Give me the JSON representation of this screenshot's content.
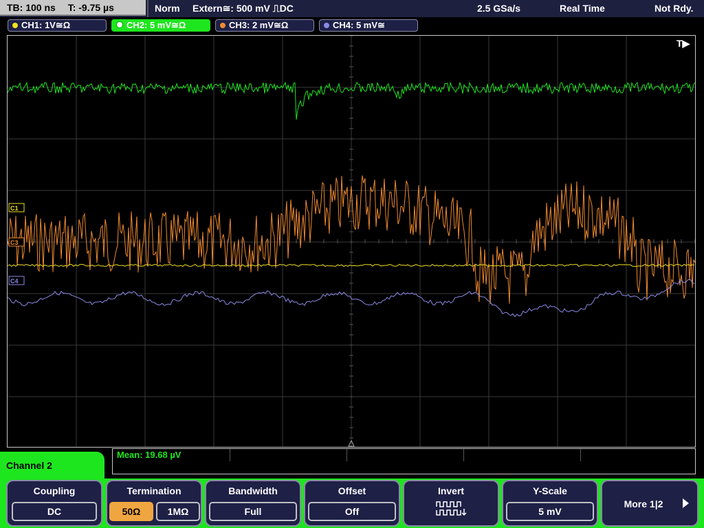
{
  "status_bar": {
    "timebase": "TB: 100 ns",
    "trigger_time": "T: -9.75 µs",
    "trigger_mode": "Norm",
    "trigger_source": "Extern≅: 500 mV ⎍DC",
    "sample_rate": "2.5 GSa/s",
    "acq_mode": "Real Time",
    "status": "Not Rdy."
  },
  "channels": [
    {
      "label": "CH1: 1V≅Ω",
      "color": "#f0e020",
      "active": false
    },
    {
      "label": "CH2: 5 mV≅Ω",
      "color": "#1ee61e",
      "active": true
    },
    {
      "label": "CH3: 2 mV≅Ω",
      "color": "#f08a30",
      "active": false
    },
    {
      "label": "CH4: 5 mV≅",
      "color": "#8a8ae6",
      "active": false
    }
  ],
  "display": {
    "trigger_marker": "T▶",
    "channel_markers": {
      "c1": "C1",
      "c3": "C3",
      "c4": "C4"
    },
    "colors": {
      "ch1": "#f0e020",
      "ch2": "#1ee61e",
      "ch3": "#f08a30",
      "ch4": "#8a8ae6",
      "grid": "#3a3a3a"
    }
  },
  "measurement": {
    "mean": "Mean: 19.68 µV"
  },
  "menu": {
    "title": "Channel 2",
    "coupling": {
      "label": "Coupling",
      "value": "DC"
    },
    "termination": {
      "label": "Termination",
      "opt1": "50Ω",
      "opt2": "1MΩ",
      "selected": "50Ω"
    },
    "bandwidth": {
      "label": "Bandwidth",
      "value": "Full"
    },
    "offset": {
      "label": "Offset",
      "value": "Off"
    },
    "invert": {
      "label": "Invert",
      "icon": "square-wave-invert-icon"
    },
    "yscale": {
      "label": "Y-Scale",
      "value": "5 mV"
    },
    "more": {
      "label": "More 1|2"
    }
  }
}
